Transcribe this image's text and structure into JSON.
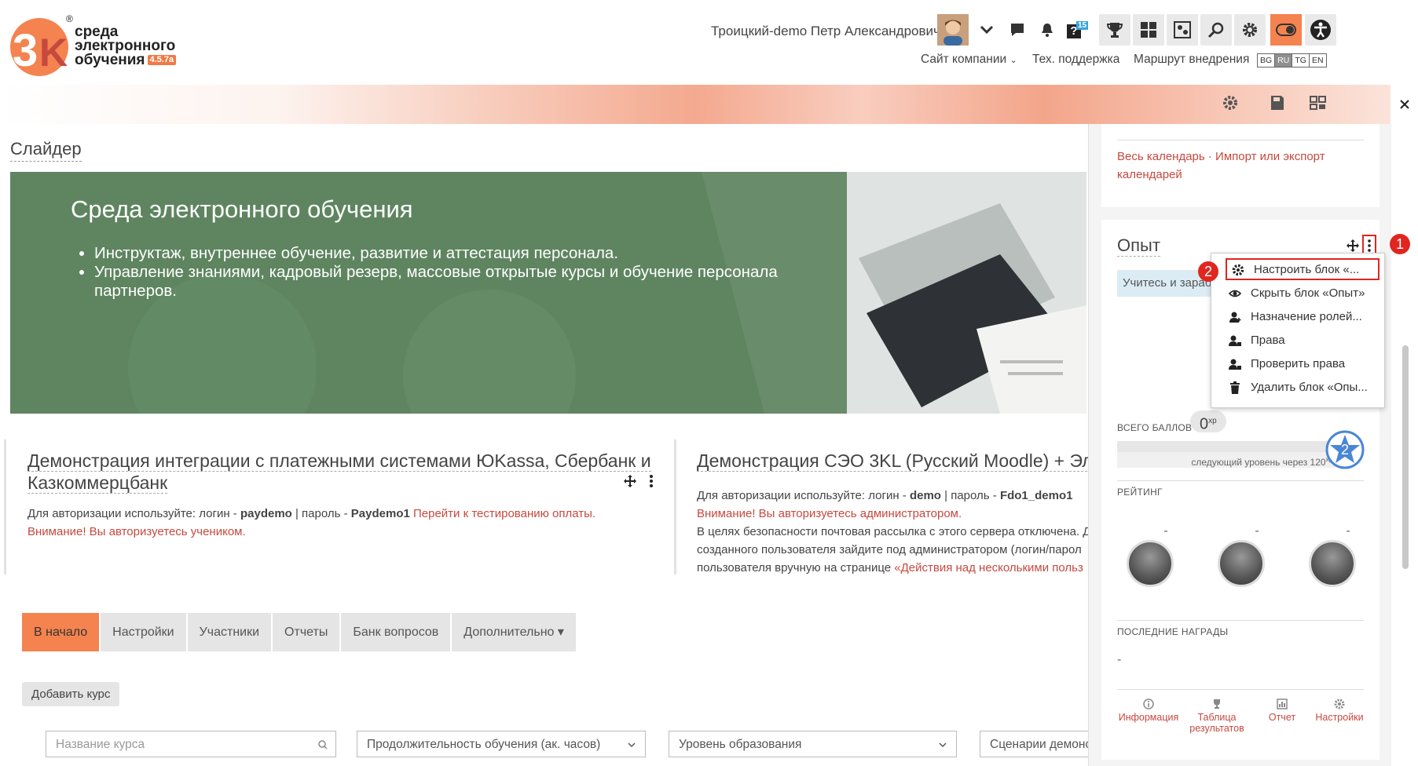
{
  "header": {
    "logo_line1": "среда",
    "logo_line2": "электронного",
    "logo_line3": "обучения",
    "logo_version": "4.5.7a",
    "logo_reg": "®",
    "user_name": "Троицкий-demo Петр Александрович",
    "notify_count": "15",
    "links": [
      "Сайт компании",
      "Тех. поддержка",
      "Маршрут внедрения"
    ],
    "languages": [
      "BG",
      "RU",
      "TG",
      "EN"
    ],
    "active_language": "RU"
  },
  "slider": {
    "block_title": "Слайдер",
    "heading": "Среда электронного обучения",
    "bullets": [
      "Инструктаж, внутреннее обучение, развитие и аттестация персонала.",
      "Управление знаниями, кадровый резерв, массовые открытые курсы и обучение персонала партнеров."
    ]
  },
  "card1": {
    "title_a": "Демонстрация интеграции с платежными системами ЮKassa, Сбербанк и",
    "title_b": "Казкоммерцбанк",
    "t1": "Для авторизации используйте: логин - ",
    "login": "paydemo",
    "t2": " | пароль - ",
    "password": "Paydemo1",
    "link": " Перейти к тестированию оплаты.",
    "warning": "Внимание! Вы авторизуетесь учеником."
  },
  "card2": {
    "title": "Демонстрация СЭО 3KL (Русский Moodle) + Элек",
    "t1": "Для авторизации используйте: логин - ",
    "login": "demo",
    "t2": " | пароль - ",
    "password": "Fdo1_demo1",
    "warning": "Внимание! Вы авторизуетесь администратором.",
    "line3": "В целях безопасности почтовая рассылка с этого сервера отключена. Д",
    "line4": "созданного пользователя зайдите под администратором (логин/парол",
    "line5a": "пользователя вручную на странице ",
    "line5b": "«Действия над несколькими польз"
  },
  "nav": {
    "tabs": [
      "В начало",
      "Настройки",
      "Участники",
      "Отчеты",
      "Банк вопросов",
      "Дополнительно ▾"
    ],
    "add_course": "Добавить курс"
  },
  "filters": {
    "course_name_placeholder": "Название курса",
    "duration": "Продолжительность обучения (ак. часов)",
    "level": "Уровень образования",
    "scenario": "Сценарии демонс"
  },
  "calendar_block": {
    "link1": "Весь календарь",
    "sep": " · ",
    "link2": "Импорт или экспорт календарей"
  },
  "xp_block": {
    "title": "Опыт",
    "learn_text": "Учитесь и зараб",
    "total_label": "ВСЕГО БАЛЛОВ",
    "total_value": "0",
    "xp_unit": "xp",
    "next_level_text": "следующий уровень через 120",
    "next_level_unit": "xp",
    "level": "2",
    "progress": 0,
    "rating_label": "РЕЙТИНГ",
    "rating_dashes": [
      "-",
      "-",
      "-"
    ],
    "awards_label": "ПОСЛЕДНИЕ НАГРАДЫ",
    "awards_value": "-",
    "footer": [
      "Информация",
      "Таблица результатов",
      "Отчет",
      "Настройки"
    ]
  },
  "menu": {
    "items": [
      "Настроить блок «...",
      "Скрыть блок «Опыт»",
      "Назначение ролей...",
      "Права",
      "Проверить права",
      "Удалить блок «Опы..."
    ]
  },
  "annotations": [
    "1",
    "2"
  ],
  "colors": {
    "accent": "#f4834f",
    "slider": "#5e8560",
    "link": "#c6493f",
    "callout": "#e0261e"
  }
}
